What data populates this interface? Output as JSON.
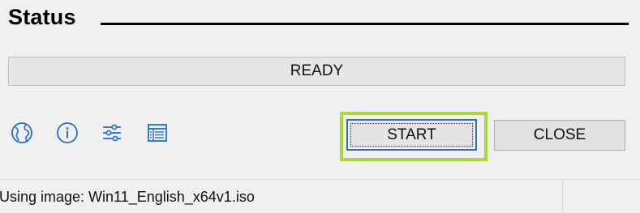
{
  "section": {
    "title": "Status"
  },
  "status_bar": {
    "text": "READY"
  },
  "toolbar": {
    "icons": [
      "globe-icon",
      "info-icon",
      "settings-sliders-icon",
      "log-icon"
    ],
    "accent_color": "#1f6fcc"
  },
  "buttons": {
    "start_label": "START",
    "close_label": "CLOSE",
    "highlight_color": "#a6d83a"
  },
  "footer": {
    "status_text": "Using image: Win11_English_x64v1.iso"
  }
}
